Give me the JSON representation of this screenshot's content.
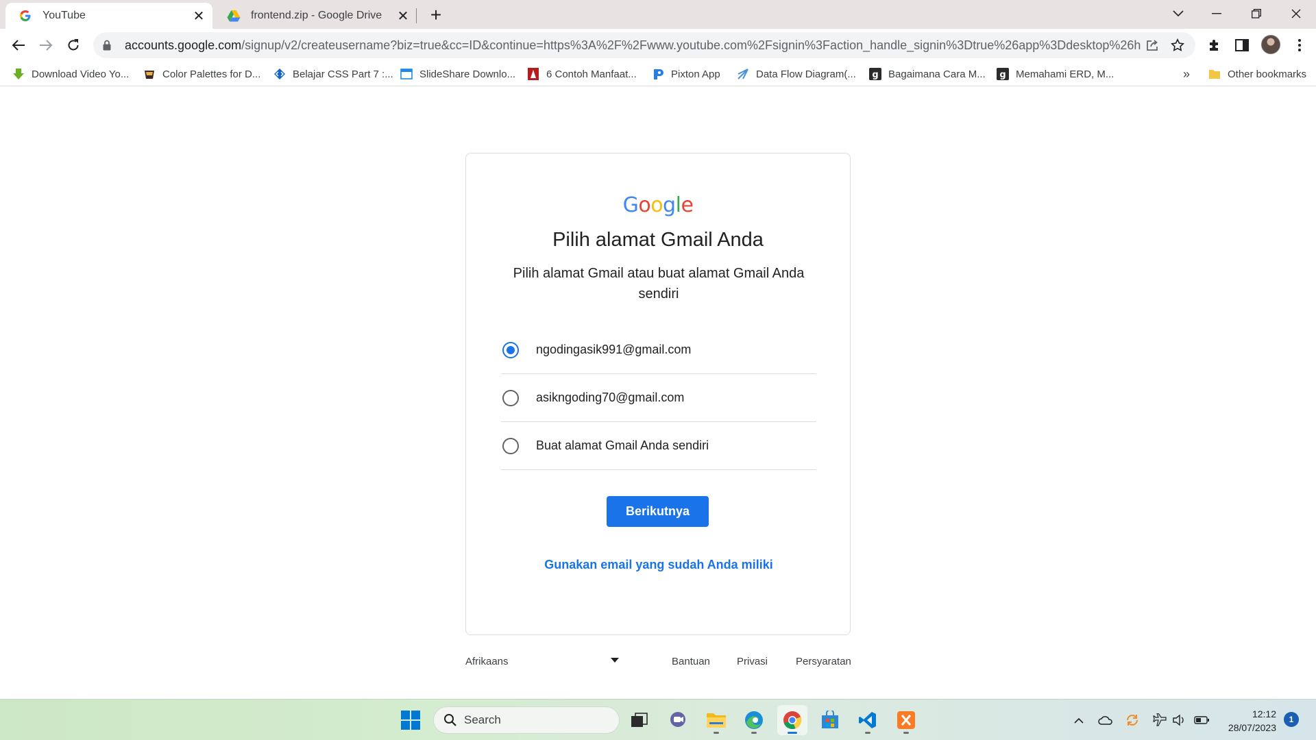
{
  "browser": {
    "tabs": [
      {
        "title": "YouTube",
        "active": true
      },
      {
        "title": "frontend.zip - Google Drive",
        "active": false
      }
    ],
    "url_host": "accounts.google.com",
    "url_path": "/signup/v2/createusername?biz=true&cc=ID&continue=https%3A%2F%2Fwww.youtube.com%2Fsignin%3Faction_handle_signin%3Dtrue%26app%3Ddesktop%26hl%3D...",
    "bookmarks": [
      "Download Video Yo...",
      "Color Palettes for D...",
      "Belajar CSS Part 7 :...",
      "SlideShare Downlo...",
      "6 Contoh Manfaat...",
      "Pixton App",
      "Data Flow Diagram(...",
      "Bagaimana Cara M...",
      "Memahami ERD, M..."
    ],
    "bookmarks_more": "»",
    "other_bookmarks": "Other bookmarks"
  },
  "page": {
    "logo_letters": [
      "G",
      "o",
      "o",
      "g",
      "l",
      "e"
    ],
    "heading": "Pilih alamat Gmail Anda",
    "subheading": "Pilih alamat Gmail atau buat alamat Gmail Anda sendiri",
    "options": [
      {
        "label": "ngodingasik991@gmail.com",
        "selected": true
      },
      {
        "label": "asikngoding70@gmail.com",
        "selected": false
      },
      {
        "label": "Buat alamat Gmail Anda sendiri",
        "selected": false
      }
    ],
    "next_button": "Berikutnya",
    "use_existing_link": "Gunakan email yang sudah Anda miliki"
  },
  "footer": {
    "language": "Afrikaans",
    "links": [
      "Bantuan",
      "Privasi",
      "Persyaratan"
    ]
  },
  "taskbar": {
    "search_label": "Search",
    "time": "12:12",
    "date": "28/07/2023",
    "notification_count": "1"
  },
  "colors": {
    "accent": "#1a73e8",
    "google_blue": "#4285f4",
    "google_red": "#ea4335",
    "google_yellow": "#fbbc05",
    "google_green": "#34a853"
  }
}
